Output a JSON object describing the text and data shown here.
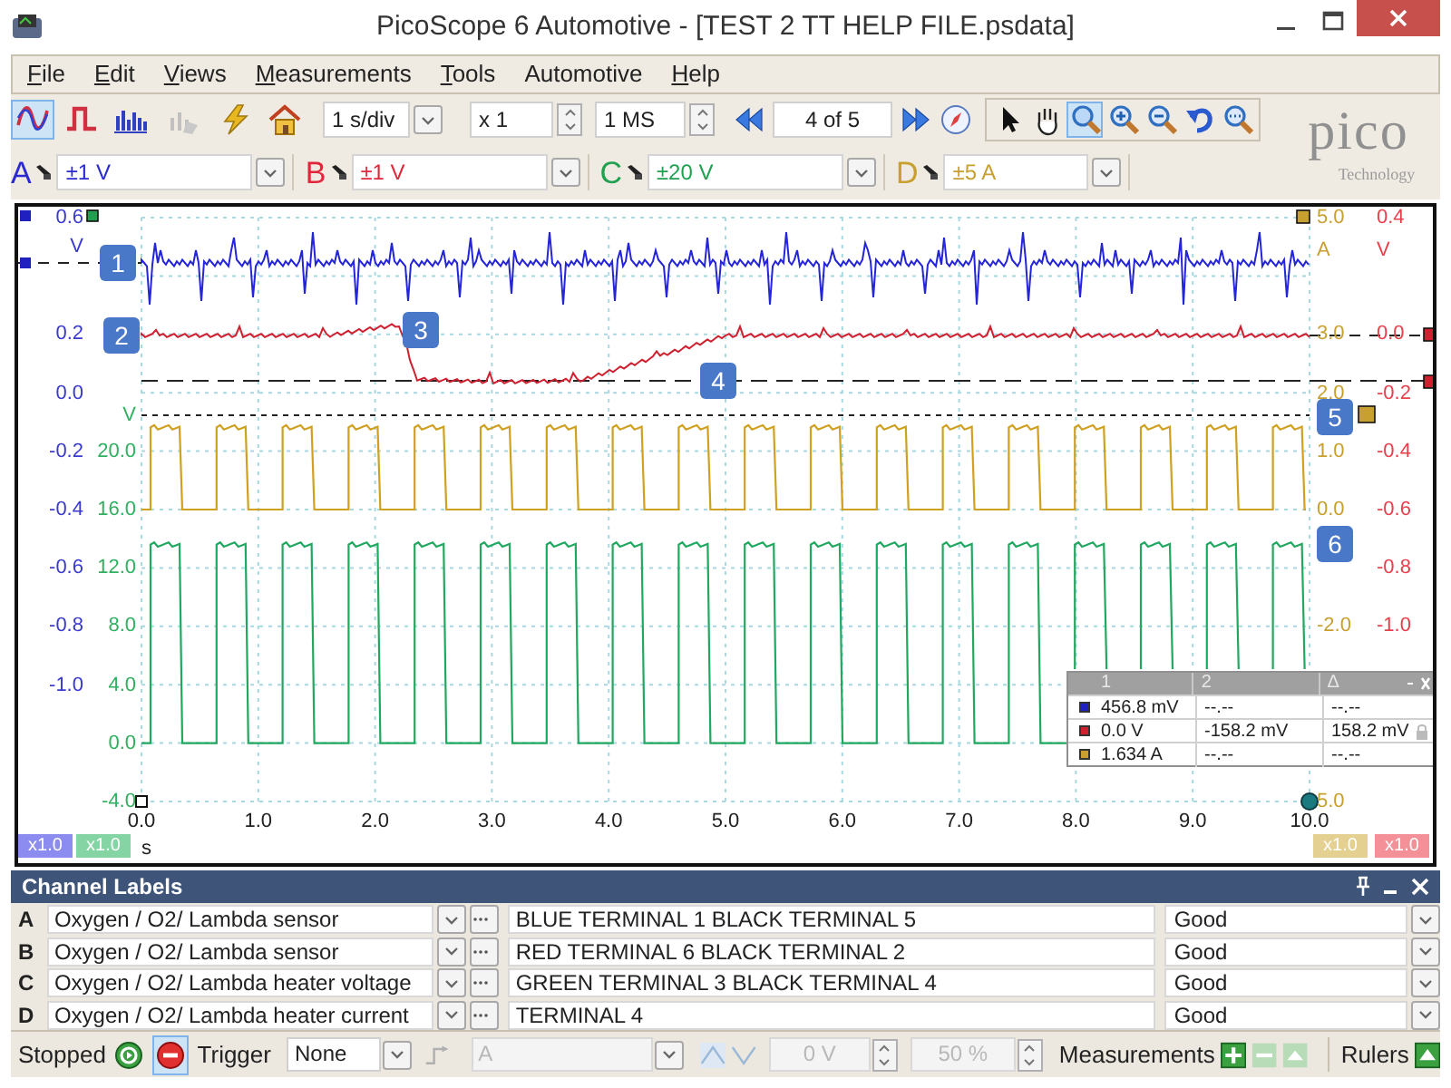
{
  "window": {
    "title": "PicoScope 6 Automotive - [TEST 2 TT HELP FILE.psdata]"
  },
  "menu": [
    {
      "mnemonic": "F",
      "rest": "ile"
    },
    {
      "mnemonic": "E",
      "rest": "dit"
    },
    {
      "mnemonic": "V",
      "rest": "iews"
    },
    {
      "mnemonic": "M",
      "rest": "easurements"
    },
    {
      "mnemonic": "T",
      "rest": "ools"
    },
    {
      "rest": "Automotive"
    },
    {
      "mnemonic": "H",
      "rest": "elp"
    }
  ],
  "toolbar": {
    "view_modes": [
      {
        "kind": "scope",
        "selected": true
      },
      {
        "kind": "persistence",
        "selected": false
      },
      {
        "kind": "spectrum",
        "selected": false
      }
    ],
    "timebase": "1 s/div",
    "zoom": "x 1",
    "samples": "1 MS",
    "buffer": "4 of 5",
    "tools": [
      {
        "kind": "pointer",
        "selected": false
      },
      {
        "kind": "hand",
        "selected": false
      },
      {
        "kind": "zoom-box",
        "selected": true
      },
      {
        "kind": "zoom-in",
        "selected": false
      },
      {
        "kind": "zoom-out",
        "selected": false
      },
      {
        "kind": "undo",
        "selected": false
      },
      {
        "kind": "zoom-overview",
        "selected": false
      }
    ]
  },
  "logo": {
    "name": "pico",
    "tagline": "Technology"
  },
  "channels": [
    {
      "letter": "A",
      "range": "±1 V",
      "color": "#2a2ad0"
    },
    {
      "letter": "B",
      "range": "±1 V",
      "color": "#e0283c"
    },
    {
      "letter": "C",
      "range": "±20 V",
      "color": "#20a050"
    },
    {
      "letter": "D",
      "range": "±5 A",
      "color": "#c8a030"
    }
  ],
  "plot": {
    "axes": [
      {
        "color": "#3a3ad0",
        "labels": [
          "0.6",
          "V",
          "0.2",
          "0.0",
          "-0.2",
          "-0.4",
          "-0.6",
          "-0.8",
          "-1.0"
        ]
      },
      {
        "color": "#30b060",
        "labels": [
          "V",
          "20.0",
          "16.0",
          "12.0",
          "8.0",
          "4.0",
          "0.0",
          "-4.0"
        ]
      },
      {
        "color": "#c8a030",
        "labels": [
          "5.0",
          "A",
          "3.0",
          "2.0",
          "1.0",
          "0.0",
          "-2.0",
          "5.0"
        ]
      },
      {
        "color": "#e8404c",
        "labels": [
          "0.4",
          "V",
          "0.0",
          "-0.2",
          "-0.4",
          "-0.6",
          "-0.8",
          "-1.0"
        ]
      }
    ],
    "x_ticks": [
      "0.0",
      "1.0",
      "2.0",
      "3.0",
      "4.0",
      "5.0",
      "6.0",
      "7.0",
      "8.0",
      "9.0",
      "10.0"
    ],
    "x_unit": "s",
    "markers": [
      "1",
      "2",
      "3",
      "4",
      "5",
      "6"
    ],
    "scale_badges": [
      {
        "text": "x1.0",
        "color": "#8c8cf0"
      },
      {
        "text": "x1.0",
        "color": "#84d4a4"
      },
      {
        "text": "x1.0",
        "color": "#e4d090"
      },
      {
        "text": "x1.0",
        "color": "#f49098"
      }
    ],
    "rulers": {
      "columns": [
        "1",
        "2",
        "Δ"
      ],
      "rows": [
        {
          "color": "#2020c0",
          "values": [
            "456.8 mV",
            "--.--",
            "--.--"
          ]
        },
        {
          "color": "#d02030",
          "values": [
            "0.0 V",
            "-158.2 mV",
            "158.2 mV"
          ],
          "locked": true
        },
        {
          "color": "#c8a030",
          "values": [
            "1.634 A",
            "--.--",
            "--.--"
          ]
        }
      ]
    }
  },
  "channel_labels": {
    "title": "Channel Labels",
    "rows": [
      {
        "channel": "A",
        "type": "Oxygen / O2/ Lambda sensor",
        "description": "BLUE TERMINAL 1 BLACK TERMINAL 5",
        "status": "Good"
      },
      {
        "channel": "B",
        "type": "Oxygen / O2/ Lambda sensor",
        "description": "RED TERMINAL 6 BLACK TERMINAL 2",
        "status": "Good"
      },
      {
        "channel": "C",
        "type": "Oxygen / O2/ Lambda heater voltage",
        "description": "GREEN TERMINAL 3 BLACK TERMINAL 4",
        "status": "Good"
      },
      {
        "channel": "D",
        "type": "Oxygen / O2/ Lambda heater current",
        "description": "TERMINAL 4",
        "status": "Good"
      }
    ]
  },
  "status_bar": {
    "state": "Stopped",
    "run_controls": [
      {
        "kind": "start",
        "selected": false
      },
      {
        "kind": "stop",
        "selected": true
      }
    ],
    "trigger_label": "Trigger",
    "trigger_mode": "None",
    "trigger_channel": {
      "value": "A",
      "disabled": true
    },
    "threshold": {
      "value": "0 V",
      "disabled": true
    },
    "pretrigger": {
      "value": "50 %",
      "disabled": true
    },
    "measurements": "Measurements",
    "rulers": "Rulers"
  }
}
